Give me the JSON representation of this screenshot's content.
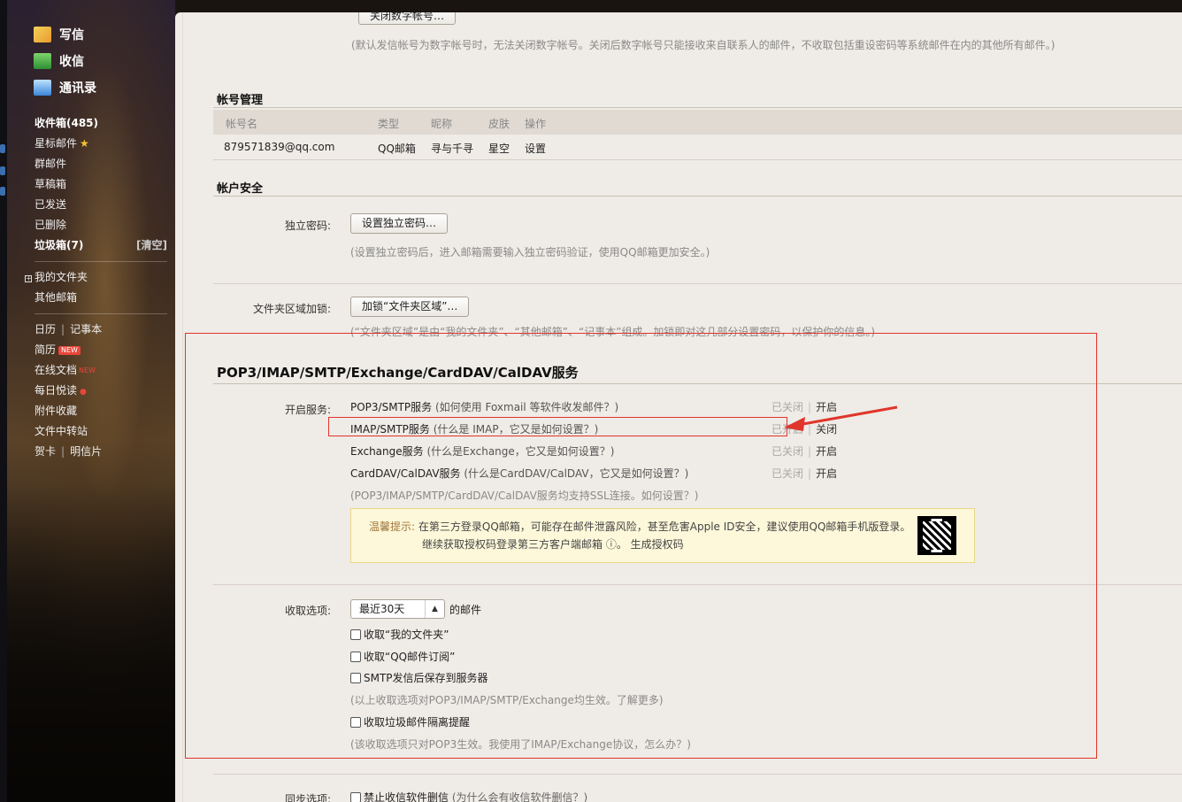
{
  "sidebar": {
    "compose": "写信",
    "receive": "收信",
    "contacts": "通讯录",
    "folders": [
      {
        "label": "收件箱(485)",
        "bold": true
      },
      {
        "label": "星标邮件",
        "star": true
      },
      {
        "label": "群邮件"
      },
      {
        "label": "草稿箱"
      },
      {
        "label": "已发送"
      },
      {
        "label": "已删除"
      },
      {
        "label": "垃圾箱(7)",
        "bold": true,
        "extra": "[清空]"
      }
    ],
    "my_folders": "我的文件夹",
    "other_mailbox": "其他邮箱",
    "calendar": "日历",
    "notes": "记事本",
    "resume": "简历",
    "resume_badge": "NEW",
    "online_docs": "在线文档",
    "online_docs_badge": "NEW",
    "daily_read": "每日悦读",
    "attachments": "附件收藏",
    "transfer": "文件中转站",
    "card": "贺卡",
    "postcard": "明信片"
  },
  "top": {
    "cut_button": "关闭数字帐号…",
    "digital_hint": "(默认发信帐号为数字帐号时，无法关闭数字帐号。关闭后数字帐号只能接收来自联系人的邮件，不收取包括重设密码等系统邮件在内的其他所有邮件。)"
  },
  "account_mgmt": {
    "title": "帐号管理",
    "headers": [
      "帐号名",
      "类型",
      "昵称",
      "皮肤",
      "操作"
    ],
    "row": [
      "879571839@qq.com",
      "QQ邮箱",
      "寻与千寻",
      "星空",
      "设置"
    ]
  },
  "security": {
    "title": "帐户安全",
    "pwd_label": "独立密码:",
    "pwd_button": "设置独立密码…",
    "pwd_hint": "(设置独立密码后，进入邮箱需要输入独立密码验证，使用QQ邮箱更加安全。)",
    "lock_label": "文件夹区域加锁:",
    "lock_button": "加锁“文件夹区域”…",
    "lock_hint": "(“文件夹区域”是由“我的文件夹”、“其他邮箱”、“记事本”组成。加锁即对这几部分设置密码，以保护你的信息。)"
  },
  "services": {
    "title": "POP3/IMAP/SMTP/Exchange/CardDAV/CalDAV服务",
    "open_label": "开启服务:",
    "items": [
      {
        "name": "POP3/SMTP服务",
        "question": "(如何使用 Foxmail 等软件收发邮件？)",
        "status": "已关闭",
        "action": "开启"
      },
      {
        "name": "IMAP/SMTP服务",
        "question": "(什么是 IMAP，它又是如何设置？)",
        "status": "已开启",
        "action": "关闭"
      },
      {
        "name": "Exchange服务",
        "question": "(什么是Exchange，它又是如何设置？)",
        "status": "已关闭",
        "action": "开启"
      },
      {
        "name": "CardDAV/CalDAV服务",
        "question": "(什么是CardDAV/CalDAV，它又是如何设置？)",
        "status": "已关闭",
        "action": "开启"
      }
    ],
    "ssl_hint": "(POP3/IMAP/SMTP/CardDAV/CalDAV服务均支持SSL连接。如何设置？)",
    "notice_label": "温馨提示:",
    "notice_line1": "在第三方登录QQ邮箱，可能存在邮件泄露风险，甚至危害Apple ID安全，建议使用QQ邮箱手机版登录。",
    "notice_line2": "继续获取授权码登录第三方客户端邮箱 ⓘ。 生成授权码"
  },
  "receive_opts": {
    "label": "收取选项:",
    "select_value": "最近30天",
    "select_suffix": "的邮件",
    "options": [
      "收取“我的文件夹”",
      "收取“QQ邮件订阅”",
      "SMTP发信后保存到服务器"
    ],
    "hint1": "(以上收取选项对POP3/IMAP/SMTP/Exchange均生效。了解更多)",
    "spam_option": "收取垃圾邮件隔离提醒",
    "hint2": "(该收取选项只对POP3生效。我使用了IMAP/Exchange协议，怎么办？)"
  },
  "sync": {
    "label": "同步选项:",
    "option": "禁止收信软件删信",
    "question": "(为什么会有收信软件删信？)"
  },
  "colors": {
    "annotation": "#e0352b",
    "accent_notice": "#fdf8da"
  }
}
